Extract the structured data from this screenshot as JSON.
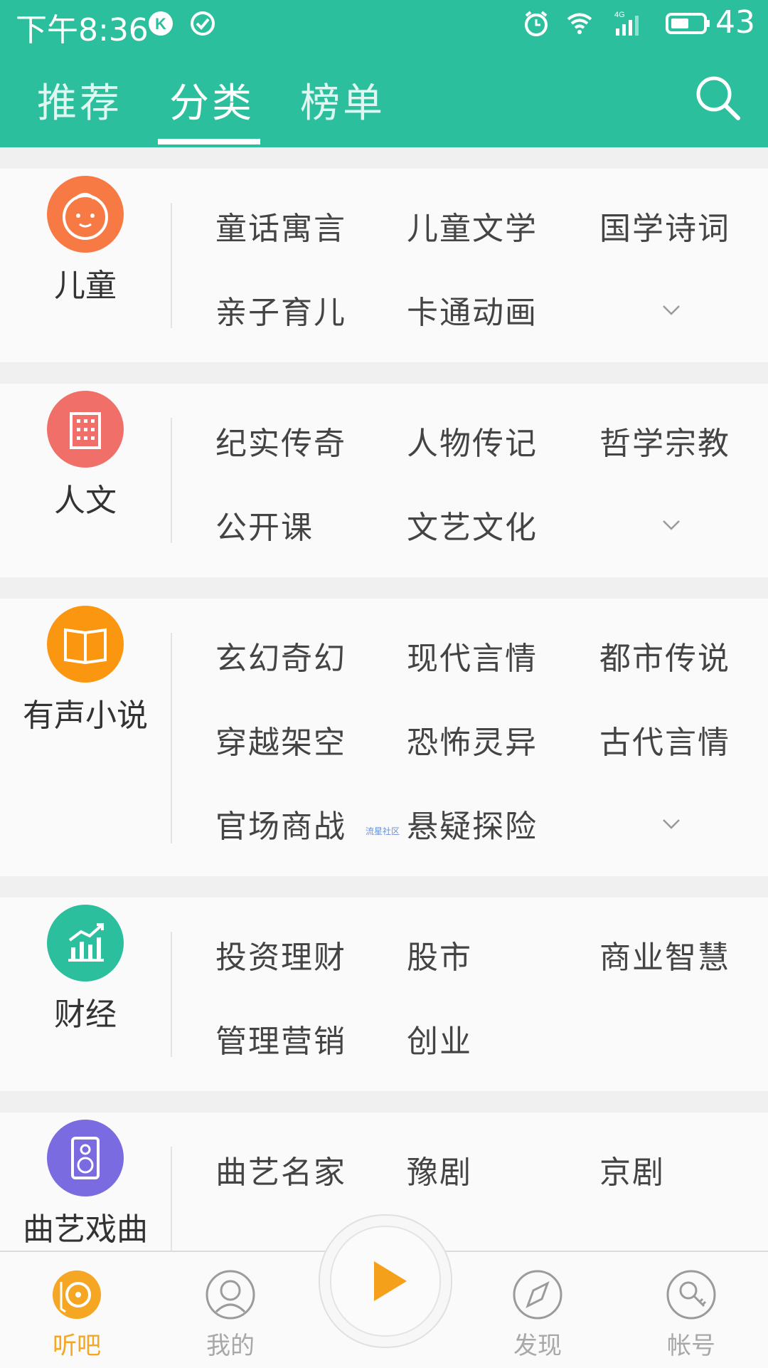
{
  "status": {
    "time": "下午8:36",
    "network": "4G",
    "battery": "43"
  },
  "tabs": [
    {
      "label": "推荐"
    },
    {
      "label": "分类"
    },
    {
      "label": "榜单"
    }
  ],
  "active_tab": "分类",
  "categories": [
    {
      "name": "儿童",
      "icon": "baby-face-icon",
      "color": "#f77a45",
      "items": [
        "童话寓言",
        "儿童文学",
        "国学诗词",
        "亲子育儿",
        "卡通动画"
      ],
      "expandable": true
    },
    {
      "name": "人文",
      "icon": "building-icon",
      "color": "#f07069",
      "items": [
        "纪实传奇",
        "人物传记",
        "哲学宗教",
        "公开课",
        "文艺文化"
      ],
      "expandable": true
    },
    {
      "name": "有声小说",
      "icon": "open-book-icon",
      "color": "#fb9611",
      "items": [
        "玄幻奇幻",
        "现代言情",
        "都市传说",
        "穿越架空",
        "恐怖灵异",
        "古代言情",
        "官场商战",
        "悬疑探险"
      ],
      "expandable": true
    },
    {
      "name": "财经",
      "icon": "chart-growth-icon",
      "color": "#2bbf9e",
      "items": [
        "投资理财",
        "股市",
        "商业智慧",
        "管理营销",
        "创业"
      ],
      "expandable": false
    },
    {
      "name": "曲艺戏曲",
      "icon": "speaker-icon",
      "color": "#7a6be0",
      "items": [
        "曲艺名家",
        "豫剧",
        "京剧"
      ],
      "expandable": false
    }
  ],
  "watermark": "流星社区",
  "bottom_nav": [
    {
      "label": "听吧",
      "icon": "record-player-icon",
      "active": true
    },
    {
      "label": "我的",
      "icon": "user-avatar-icon",
      "active": false
    },
    {
      "label": "发现",
      "icon": "compass-icon",
      "active": false
    },
    {
      "label": "帐号",
      "icon": "account-key-icon",
      "active": false
    }
  ],
  "colors": {
    "primary": "#2bbf9e",
    "accent": "#f5a623",
    "play": "#f5a01a"
  }
}
